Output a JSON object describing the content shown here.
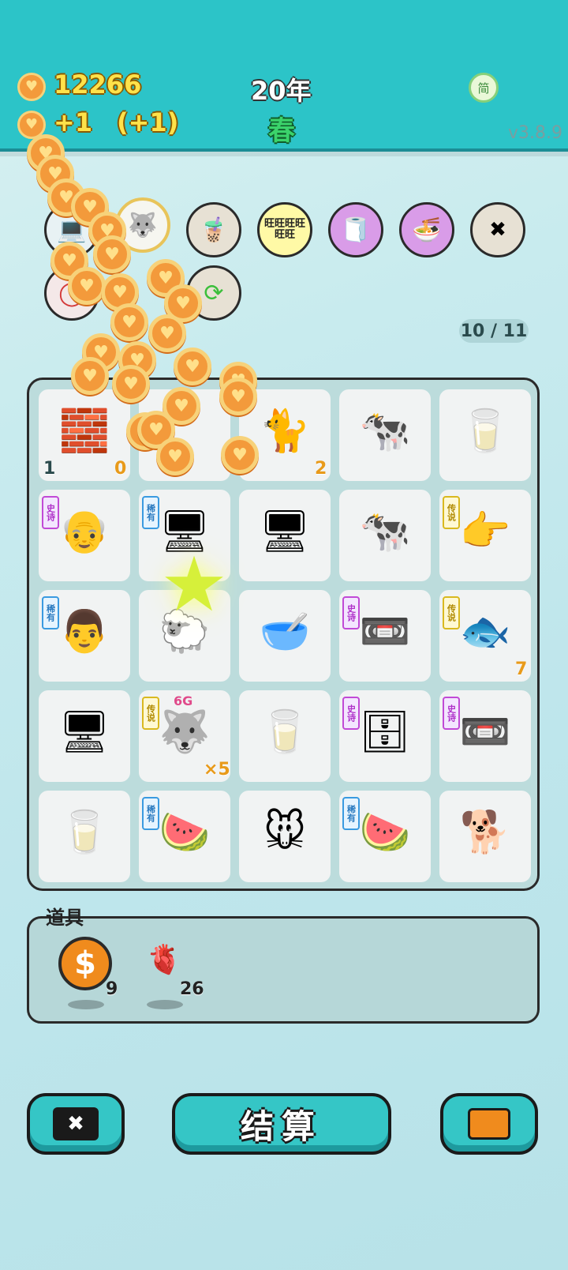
{
  "header": {
    "coins": "12266",
    "income": "+1",
    "income_bonus": "(+1)",
    "year": "20年",
    "season": "春",
    "lang_button": "简",
    "version": "v3.8.9"
  },
  "skills_row1": [
    {
      "icon": "computer-icon"
    },
    {
      "icon": "husky-icon"
    },
    {
      "icon": "milk-tea-icon"
    },
    {
      "icon": "wangwang-icon",
      "text": "旺旺旺旺旺旺"
    },
    {
      "icon": "tissue-box-icon"
    },
    {
      "icon": "bowls-up-icon"
    },
    {
      "icon": "delete-card-icon"
    }
  ],
  "skills_row2": [
    {
      "icon": "red-ring-icon"
    },
    {
      "icon": "refresh-icon"
    }
  ],
  "draw_counter": "10 / 11",
  "board": [
    [
      {
        "icon": "silver-bars-icon",
        "emoji": "🧱",
        "count_left": "1",
        "count": "0"
      },
      {
        "icon": "empty-icon",
        "emoji": ""
      },
      {
        "icon": "cat-icon",
        "emoji": "🐈",
        "count": "2"
      },
      {
        "icon": "cow-icon",
        "emoji": "🐄"
      },
      {
        "icon": "milk-icon",
        "emoji": "🥛"
      }
    ],
    [
      {
        "icon": "old-man-icon",
        "emoji": "👴",
        "tag": "史诗",
        "tag_type": "epic"
      },
      {
        "icon": "server-icon",
        "emoji": "🖥",
        "tag": "稀有",
        "tag_type": "rare"
      },
      {
        "icon": "desktop-icon",
        "emoji": "🖥"
      },
      {
        "icon": "cow-icon",
        "emoji": "🐄"
      },
      {
        "icon": "pointing-hand-icon",
        "emoji": "👉",
        "tag": "传说",
        "tag_type": "legend"
      }
    ],
    [
      {
        "icon": "man-glasses-icon",
        "emoji": "👨",
        "tag": "稀有",
        "tag_type": "rare"
      },
      {
        "icon": "sheep-icon",
        "emoji": "🐑"
      },
      {
        "icon": "bowl-icon",
        "emoji": "🥣"
      },
      {
        "icon": "graphics-card-icon",
        "emoji": "📼",
        "tag": "史诗",
        "tag_type": "epic"
      },
      {
        "icon": "koi-fish-icon",
        "emoji": "🐟",
        "tag": "传说",
        "tag_type": "legend",
        "count": "7"
      }
    ],
    [
      {
        "icon": "desktop-icon",
        "emoji": "🖥"
      },
      {
        "icon": "husky-king-icon",
        "emoji": "🐺",
        "tag": "传说",
        "tag_type": "legend",
        "count": "×5",
        "badge": "6G"
      },
      {
        "icon": "milk-icon",
        "emoji": "🥛"
      },
      {
        "icon": "server-rack-icon",
        "emoji": "🗄",
        "tag": "史诗",
        "tag_type": "epic"
      },
      {
        "icon": "graphics-card-icon",
        "emoji": "📼",
        "tag": "史诗",
        "tag_type": "epic"
      }
    ],
    [
      {
        "icon": "milk-icon",
        "emoji": "🥛"
      },
      {
        "icon": "watermelon-icon",
        "emoji": "🍉",
        "tag": "稀有",
        "tag_type": "rare"
      },
      {
        "icon": "mouse-icon",
        "emoji": "🐭"
      },
      {
        "icon": "watermelon-icon",
        "emoji": "🍉",
        "tag": "稀有",
        "tag_type": "rare"
      },
      {
        "icon": "dog-icon",
        "emoji": "🐕"
      }
    ]
  ],
  "props": {
    "label": "道具",
    "items": [
      {
        "icon": "dollar-coin-icon",
        "glyph": "$",
        "count": "9"
      },
      {
        "icon": "liver-icon",
        "glyph": "🫀",
        "count": "26"
      }
    ]
  },
  "buttons": {
    "delete_icon": "delete-card-icon",
    "settle_label": "结算",
    "bag_icon": "briefcase-icon"
  },
  "colors": {
    "topbar": "#2cc4c8",
    "coin": "#f39a3b",
    "button": "#35c6c6"
  }
}
